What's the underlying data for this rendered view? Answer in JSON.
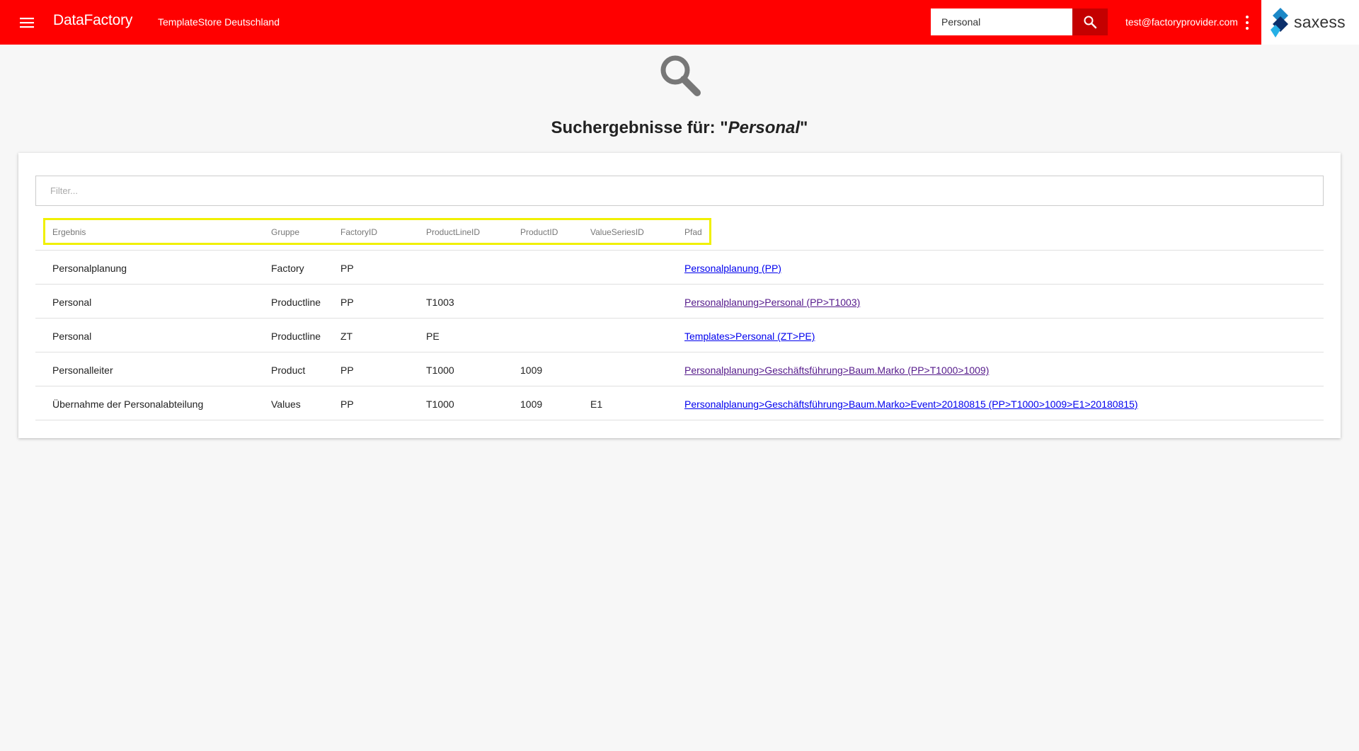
{
  "header": {
    "brand": "DataFactory",
    "store": "TemplateStore Deutschland",
    "search_value": "Personal",
    "user_email": "test@factoryprovider.com",
    "logo_text": "saxess",
    "accent_color": "#ff0000",
    "search_button_color": "#c40000"
  },
  "results": {
    "title_prefix": "Suchergebnisse für: \"",
    "query": "Personal",
    "title_suffix": "\"",
    "filter_placeholder": "Filter...",
    "columns": [
      "Ergebnis",
      "Gruppe",
      "FactoryID",
      "ProductLineID",
      "ProductID",
      "ValueSeriesID",
      "Pfad"
    ],
    "rows": [
      {
        "ergebnis": "Personalplanung",
        "gruppe": "Factory",
        "factory_id": "PP",
        "productline_id": "",
        "product_id": "",
        "valueseries_id": "",
        "pfad": "Personalplanung (PP)"
      },
      {
        "ergebnis": "Personal",
        "gruppe": "Productline",
        "factory_id": "PP",
        "productline_id": "T1003",
        "product_id": "",
        "valueseries_id": "",
        "pfad": "Personalplanung>Personal (PP>T1003)"
      },
      {
        "ergebnis": "Personal",
        "gruppe": "Productline",
        "factory_id": "ZT",
        "productline_id": "PE",
        "product_id": "",
        "valueseries_id": "",
        "pfad": "Templates>Personal (ZT>PE)"
      },
      {
        "ergebnis": "Personalleiter",
        "gruppe": "Product",
        "factory_id": "PP",
        "productline_id": "T1000",
        "product_id": "1009",
        "valueseries_id": "",
        "pfad": "Personalplanung>Geschäftsführung>Baum.Marko (PP>T1000>1009)"
      },
      {
        "ergebnis": "Übernahme der Personalabteilung",
        "gruppe": "Values",
        "factory_id": "PP",
        "productline_id": "T1000",
        "product_id": "1009",
        "valueseries_id": "E1",
        "pfad": "Personalplanung>Geschäftsführung>Baum.Marko>Event>20180815 (PP>T1000>1009>E1>20180815)"
      }
    ]
  },
  "icons": {
    "menu": "hamburger-menu-icon",
    "search": "magnifier-icon",
    "more": "kebab-more-icon",
    "logo": "saxess-diamond-logo",
    "hero": "large-search-icon"
  }
}
